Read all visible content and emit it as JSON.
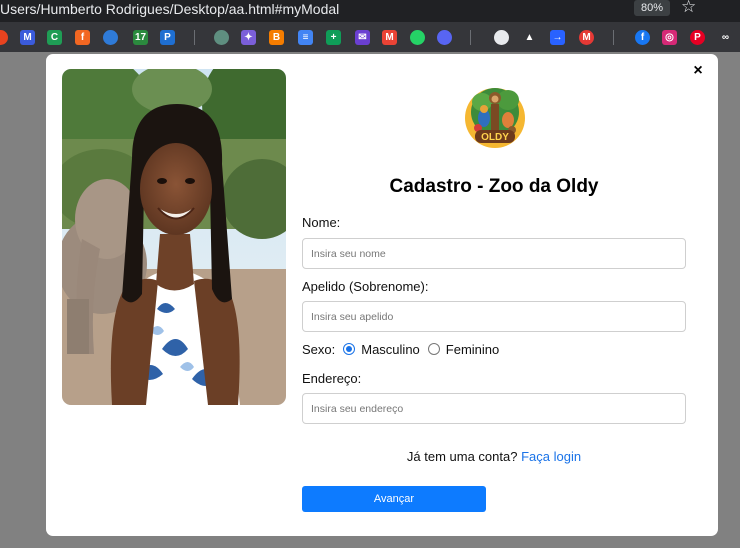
{
  "browser": {
    "url": "Users/Humberto Rodrigues/Desktop/aa.html#myModal",
    "zoom": "80%",
    "bookmarks": [
      {
        "name": "bookmark-1-icon",
        "glyph": "",
        "color": "#e8431f",
        "round": true
      },
      {
        "name": "bookmark-2-icon",
        "glyph": "M",
        "color": "#3b5bdb"
      },
      {
        "name": "bookmark-3-icon",
        "glyph": "C",
        "color": "#1f9d55"
      },
      {
        "name": "bookmark-4-icon",
        "glyph": "f",
        "color": "#f26722"
      },
      {
        "name": "bookmark-5-icon",
        "glyph": "",
        "color": "#2f7bd8",
        "round": true
      },
      {
        "name": "bookmark-6-icon",
        "glyph": "17",
        "color": "#2b8a3e"
      },
      {
        "name": "bookmark-7-icon",
        "glyph": "P",
        "color": "#1f6fd1"
      },
      {
        "name": "chatgpt-icon",
        "glyph": "",
        "color": "#5f8f80",
        "round": true
      },
      {
        "name": "gemini-icon",
        "glyph": "✦",
        "color": "#7b5fd9"
      },
      {
        "name": "blogger-icon",
        "glyph": "B",
        "color": "#f57d00"
      },
      {
        "name": "google-docs-icon",
        "glyph": "≡",
        "color": "#4285f4"
      },
      {
        "name": "google-sheets-icon",
        "glyph": "+",
        "color": "#0f9d58"
      },
      {
        "name": "mail-icon",
        "glyph": "✉",
        "color": "#6a3fd1"
      },
      {
        "name": "gmail-icon",
        "glyph": "M",
        "color": "#ea4335"
      },
      {
        "name": "whatsapp-icon",
        "glyph": "",
        "color": "#25d366",
        "round": true
      },
      {
        "name": "discord-icon",
        "glyph": "",
        "color": "#5865f2",
        "round": true
      },
      {
        "name": "github-icon",
        "glyph": "",
        "color": "#e8eaed",
        "round": true
      },
      {
        "name": "google-drive-icon",
        "glyph": "▲",
        "color": "#35363a"
      },
      {
        "name": "bookmark-arrow-icon",
        "glyph": "→",
        "color": "#2962ff"
      },
      {
        "name": "bookmark-red-icon",
        "glyph": "M",
        "color": "#e53935",
        "round": true
      },
      {
        "name": "facebook-icon",
        "glyph": "f",
        "color": "#1877f2",
        "round": true
      },
      {
        "name": "instagram-icon",
        "glyph": "◎",
        "color": "#d62976"
      },
      {
        "name": "pinterest-icon",
        "glyph": "P",
        "color": "#e60023",
        "round": true
      },
      {
        "name": "meta-icon",
        "glyph": "∞",
        "color": "#35363a"
      }
    ]
  },
  "modal": {
    "close": "×",
    "title": "Cadastro - Zoo da Oldy",
    "logo_text": "OLDY",
    "fields": {
      "nome_label": "Nome:",
      "nome_placeholder": "Insira seu nome",
      "apelido_label": "Apelido (Sobrenome):",
      "apelido_placeholder": "Insira seu apelido",
      "sexo_label": "Sexo:",
      "masculino": "Masculino",
      "feminino": "Feminino",
      "endereco_label": "Endereço:",
      "endereco_placeholder": "Insira seu endereço"
    },
    "login_prompt": "Já tem uma conta?",
    "login_link": "Faça login",
    "submit": "Avançar"
  }
}
